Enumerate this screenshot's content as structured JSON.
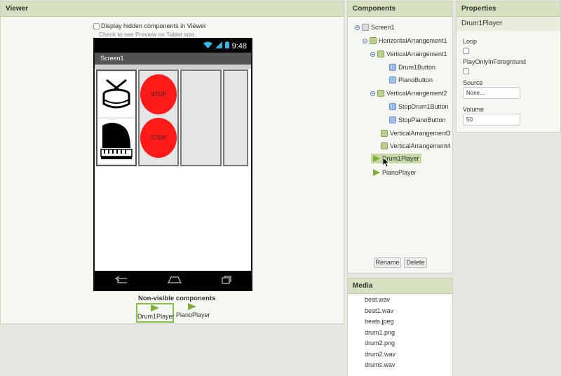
{
  "viewer": {
    "title": "Viewer",
    "hidden_checkbox_label": "Display hidden components in Viewer",
    "hint": "Check to see Preview on Tablet size.",
    "phone": {
      "time": "9:48",
      "screen_title": "Screen1",
      "stop_label_1": "STOP",
      "stop_label_2": "STOP"
    },
    "nonvisible_title": "Non-visible components",
    "nonvisible": [
      {
        "label": "Drum1Player"
      },
      {
        "label": "PianoPlayer"
      }
    ]
  },
  "components": {
    "title": "Components",
    "tree": [
      {
        "label": "Screen1",
        "icon": "screen-icon"
      },
      {
        "label": "HorizontalArrangement1",
        "icon": "horizontal-arrangement-icon"
      },
      {
        "label": "VerticalArrangement1",
        "icon": "vertical-arrangement-icon"
      },
      {
        "label": "Drum1Button",
        "icon": "button-icon"
      },
      {
        "label": "PianoButton",
        "icon": "button-icon"
      },
      {
        "label": "VerticalArrangement2",
        "icon": "vertical-arrangement-icon"
      },
      {
        "label": "StopDrum1Button",
        "icon": "button-icon"
      },
      {
        "label": "StopPianoButton",
        "icon": "button-icon"
      },
      {
        "label": "VerticalArrangement3",
        "icon": "vertical-arrangement-icon"
      },
      {
        "label": "VerticalArrangement4",
        "icon": "vertical-arrangement-icon"
      },
      {
        "label": "Drum1Player",
        "icon": "player-icon",
        "selected": true
      },
      {
        "label": "PianoPlayer",
        "icon": "player-icon"
      }
    ],
    "rename_label": "Rename",
    "delete_label": "Delete"
  },
  "properties": {
    "title": "Properties",
    "component": "Drum1Player",
    "loop_label": "Loop",
    "play_fg_label": "PlayOnlyInForeground",
    "source_label": "Source",
    "source_value": "None...",
    "volume_label": "Volume",
    "volume_value": "50"
  },
  "media": {
    "title": "Media",
    "files": [
      "beat.wav",
      "beat1.wav",
      "beats.jpeg",
      "drum1.png",
      "drum2.png",
      "drum2.wav",
      "drums.wav"
    ]
  },
  "colors": {
    "header_green": "#d7e1c2",
    "stop_red": "#ff1a1a",
    "selection_green": "#8bc34a"
  }
}
